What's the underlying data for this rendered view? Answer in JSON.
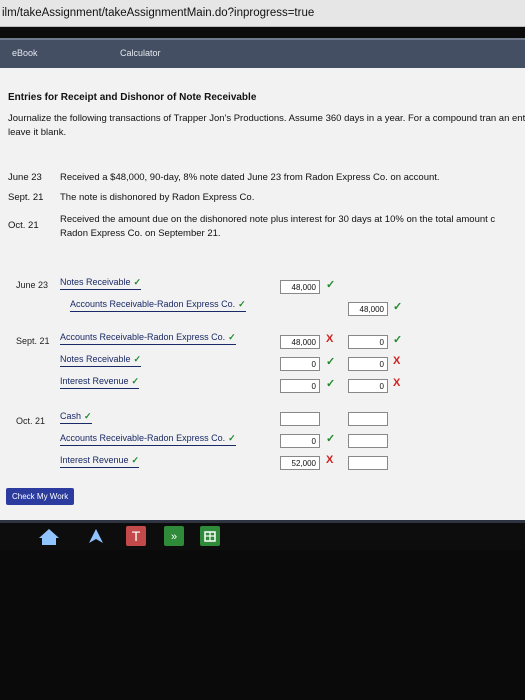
{
  "url": "ilm/takeAssignment/takeAssignmentMain.do?inprogress=true",
  "tabs": {
    "ebook": "eBook",
    "calculator": "Calculator"
  },
  "problem": {
    "title": "Entries for Receipt and Dishonor of Note Receivable",
    "instruction": "Journalize the following transactions of Trapper Jon's Productions. Assume 360 days in a year. For a compound tran an entry, leave it blank.",
    "transactions": [
      {
        "date": "June 23",
        "text": "Received a $48,000, 90-day, 8% note dated June 23 from Radon Express Co. on account."
      },
      {
        "date": "Sept. 21",
        "text": "The note is dishonored by Radon Express Co."
      },
      {
        "date": "Oct. 21",
        "text": "Received the amount due on the dishonored note plus interest for 30 days at 10% on the total amount c",
        "text2": "Radon Express Co. on September 21."
      }
    ]
  },
  "journal": {
    "june23": {
      "date": "June 23",
      "r1": {
        "account": "Notes Receivable",
        "debit": "48,000"
      },
      "r2": {
        "account": "Accounts Receivable-Radon Express Co.",
        "credit": "48,000"
      }
    },
    "sept21": {
      "date": "Sept. 21",
      "r1": {
        "account": "Accounts Receivable-Radon Express Co.",
        "debit": "48,000",
        "credit": "0"
      },
      "r2": {
        "account": "Notes Receivable",
        "debit": "0",
        "credit": "0"
      },
      "r3": {
        "account": "Interest Revenue",
        "debit": "0",
        "credit": "0"
      }
    },
    "oct21": {
      "date": "Oct. 21",
      "r1": {
        "account": "Cash"
      },
      "r2": {
        "account": "Accounts Receivable-Radon Express Co.",
        "debit": "0"
      },
      "r3": {
        "account": "Interest Revenue",
        "debit": "52,000"
      }
    }
  },
  "marks": {
    "check": "✓",
    "cross": "X"
  },
  "check_button": "Check My Work",
  "colors": {
    "accent": "#2b3c9e",
    "correct": "#1e8a2a",
    "incorrect": "#d21f1f"
  }
}
